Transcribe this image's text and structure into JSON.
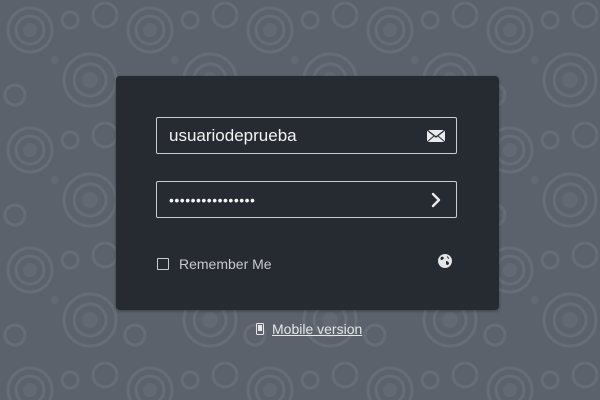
{
  "login": {
    "username_value": "usuariodeprueba",
    "password_value": "••••••••••••••••",
    "remember_label": "Remember Me"
  },
  "footer": {
    "mobile_link": "Mobile version"
  },
  "icons": {
    "username": "envelope-icon",
    "submit": "chevron-right-icon",
    "language": "globe-icon",
    "mobile": "mobile-phone-icon"
  },
  "colors": {
    "background": "#5b626b",
    "panel": "#262b31",
    "field_border": "#c9ccd0",
    "text": "#f2f3f4"
  }
}
